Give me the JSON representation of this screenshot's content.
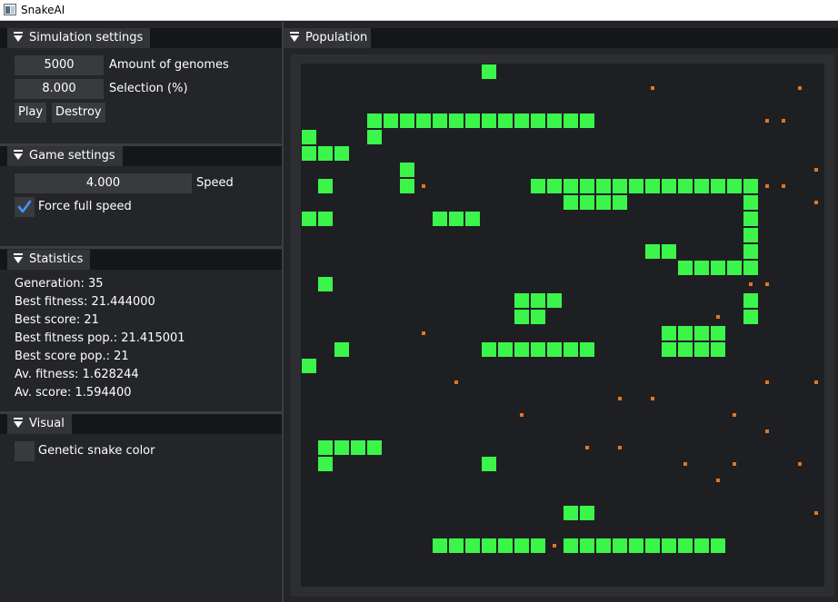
{
  "window": {
    "title": "SnakeAI"
  },
  "simulation": {
    "header": "Simulation settings",
    "genomes_value": "5000",
    "genomes_label": "Amount of genomes",
    "selection_value": "8.000",
    "selection_label": "Selection (%)",
    "play_label": "Play",
    "destroy_label": "Destroy"
  },
  "game": {
    "header": "Game settings",
    "speed_value": "4.000",
    "speed_label": "Speed",
    "force_label": "Force full speed",
    "force_checked": true
  },
  "statistics": {
    "header": "Statistics",
    "generation": "Generation: 35",
    "best_fitness": "Best fitness: 21.444000",
    "best_score": "Best score: 21",
    "best_fitness_pop": "Best fitness pop.: 21.415001",
    "best_score_pop": "Best score pop.: 21",
    "avg_fitness": "Av. fitness: 1.628244",
    "avg_score": "Av. score: 1.594400"
  },
  "visual": {
    "header": "Visual",
    "genetic_color_label": "Genetic snake color",
    "genetic_color_checked": false
  },
  "population": {
    "header": "Population",
    "snake_color": "#3cf54b",
    "food_color": "#e37622",
    "grid_cols": 32,
    "grid_rows": 32,
    "snake_cells": [
      [
        11,
        0
      ],
      [
        4,
        3
      ],
      [
        5,
        3
      ],
      [
        6,
        3
      ],
      [
        7,
        3
      ],
      [
        8,
        3
      ],
      [
        9,
        3
      ],
      [
        10,
        3
      ],
      [
        11,
        3
      ],
      [
        12,
        3
      ],
      [
        13,
        3
      ],
      [
        14,
        3
      ],
      [
        15,
        3
      ],
      [
        16,
        3
      ],
      [
        17,
        3
      ],
      [
        0,
        4
      ],
      [
        4,
        4
      ],
      [
        0,
        5
      ],
      [
        1,
        5
      ],
      [
        2,
        5
      ],
      [
        6,
        6
      ],
      [
        1,
        7
      ],
      [
        6,
        7
      ],
      [
        14,
        7
      ],
      [
        15,
        7
      ],
      [
        16,
        7
      ],
      [
        17,
        7
      ],
      [
        18,
        7
      ],
      [
        19,
        7
      ],
      [
        20,
        7
      ],
      [
        21,
        7
      ],
      [
        22,
        7
      ],
      [
        23,
        7
      ],
      [
        24,
        7
      ],
      [
        25,
        7
      ],
      [
        26,
        7
      ],
      [
        27,
        7
      ],
      [
        16,
        8
      ],
      [
        17,
        8
      ],
      [
        18,
        8
      ],
      [
        19,
        8
      ],
      [
        27,
        8
      ],
      [
        0,
        9
      ],
      [
        1,
        9
      ],
      [
        8,
        9
      ],
      [
        9,
        9
      ],
      [
        10,
        9
      ],
      [
        27,
        9
      ],
      [
        27,
        10
      ],
      [
        21,
        11
      ],
      [
        22,
        11
      ],
      [
        27,
        11
      ],
      [
        23,
        12
      ],
      [
        24,
        12
      ],
      [
        25,
        12
      ],
      [
        26,
        12
      ],
      [
        27,
        12
      ],
      [
        1,
        13
      ],
      [
        13,
        14
      ],
      [
        14,
        14
      ],
      [
        15,
        14
      ],
      [
        27,
        14
      ],
      [
        13,
        15
      ],
      [
        14,
        15
      ],
      [
        27,
        15
      ],
      [
        22,
        16
      ],
      [
        23,
        16
      ],
      [
        24,
        16
      ],
      [
        25,
        16
      ],
      [
        2,
        17
      ],
      [
        11,
        17
      ],
      [
        12,
        17
      ],
      [
        13,
        17
      ],
      [
        14,
        17
      ],
      [
        15,
        17
      ],
      [
        16,
        17
      ],
      [
        17,
        17
      ],
      [
        22,
        17
      ],
      [
        23,
        17
      ],
      [
        24,
        17
      ],
      [
        25,
        17
      ],
      [
        0,
        18
      ],
      [
        1,
        23
      ],
      [
        2,
        23
      ],
      [
        3,
        23
      ],
      [
        4,
        23
      ],
      [
        1,
        24
      ],
      [
        11,
        24
      ],
      [
        16,
        27
      ],
      [
        17,
        27
      ],
      [
        8,
        29
      ],
      [
        9,
        29
      ],
      [
        10,
        29
      ],
      [
        11,
        29
      ],
      [
        12,
        29
      ],
      [
        13,
        29
      ],
      [
        14,
        29
      ],
      [
        16,
        29
      ],
      [
        17,
        29
      ],
      [
        18,
        29
      ],
      [
        19,
        29
      ],
      [
        20,
        29
      ],
      [
        21,
        29
      ],
      [
        22,
        29
      ],
      [
        23,
        29
      ],
      [
        24,
        29
      ],
      [
        25,
        29
      ]
    ],
    "food_cells": [
      [
        21,
        1
      ],
      [
        30,
        1
      ],
      [
        28,
        3
      ],
      [
        29,
        3
      ],
      [
        31,
        6
      ],
      [
        7,
        7
      ],
      [
        28,
        7
      ],
      [
        29,
        7
      ],
      [
        31,
        8
      ],
      [
        27,
        13
      ],
      [
        28,
        13
      ],
      [
        25,
        15
      ],
      [
        7,
        16
      ],
      [
        9,
        19
      ],
      [
        28,
        19
      ],
      [
        31,
        19
      ],
      [
        19,
        20
      ],
      [
        21,
        20
      ],
      [
        13,
        21
      ],
      [
        26,
        21
      ],
      [
        28,
        22
      ],
      [
        17,
        23
      ],
      [
        19,
        23
      ],
      [
        23,
        24
      ],
      [
        26,
        24
      ],
      [
        30,
        24
      ],
      [
        25,
        25
      ],
      [
        31,
        27
      ],
      [
        15,
        29
      ]
    ]
  }
}
